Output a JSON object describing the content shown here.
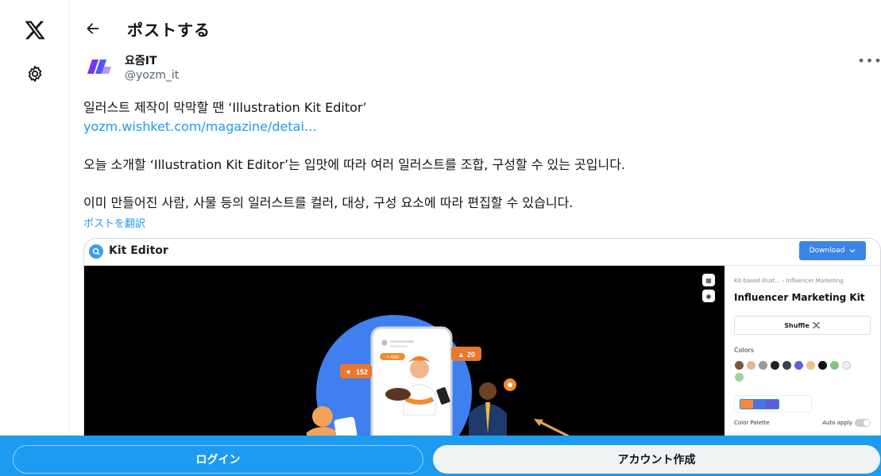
{
  "nav": {
    "logo_icon": "x-logo-icon",
    "settings_icon": "gear-icon"
  },
  "header": {
    "title": "ポストする",
    "back_icon": "arrow-left-icon"
  },
  "post": {
    "display_name": "요즘IT",
    "handle": "@yozm_it",
    "more_icon": "more-horizontal-icon",
    "lines": [
      "일러스트 제작이 막막할 땐 ‘Illustration Kit Editor’",
      "오늘 소개할 ‘Illustration Kit Editor’는 입맛에 따라 여러 일러스트를 조합, 구성할 수 있는 곳입니다.",
      "이미 만들어진 사람, 사물 등의 일러스트를 컬러, 대상, 구성 요소에 따라 편집할 수 있습니다."
    ],
    "link": "yozm.wishket.com/magazine/detai…",
    "translate": "ポストを翻訳"
  },
  "media": {
    "app_title": "Kit Editor",
    "download_label": "Download",
    "crumbs": "Kit based illust...  › Influencer Marketing",
    "kit_name": "Influencer Marketing Kit",
    "shuffle_label": "Shuffle",
    "colors_label": "Colors",
    "palette_label": "Color Palette",
    "auto_apply_label": "Auto apply",
    "likes_badge": "152",
    "thumbs_badge": "20",
    "phone_tag": "+ Add",
    "swatches": [
      "#7a5a3c",
      "#e3b98f",
      "#9a9a9a",
      "#222222",
      "#3b4456",
      "#5b63d6",
      "#e9c48f",
      "#111111",
      "#7cc97a",
      "#eeeeee",
      "#9fd49d"
    ],
    "palette": [
      "#f08b3c",
      "#4b73e0",
      "#5a5fd8"
    ]
  },
  "bottom": {
    "login": "ログイン",
    "signup": "アカウント作成"
  },
  "colors": {
    "accent": "#1d9bf0",
    "text": "#0f1419",
    "muted": "#536471"
  }
}
